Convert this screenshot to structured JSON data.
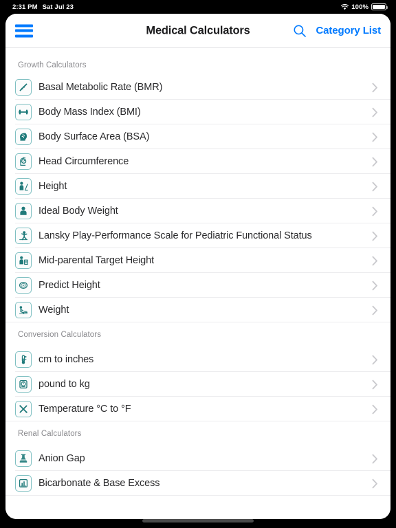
{
  "status_bar": {
    "time": "2:31 PM",
    "date": "Sat Jul 23",
    "battery_percent": "100%",
    "wifi_icon": "wifi-icon",
    "battery_icon": "battery-icon"
  },
  "nav": {
    "menu_icon": "hamburger-menu-icon",
    "title": "Medical Calculators",
    "search_icon": "search-icon",
    "category_list_label": "Category List"
  },
  "colors": {
    "accent_blue": "#007aff",
    "icon_teal": "#1f7a7a",
    "icon_border": "#7fc0c2",
    "section_header_text": "#8a8a8e",
    "row_text": "#2a2a2c",
    "separator": "#ececee"
  },
  "sections": [
    {
      "title": "Growth Calculators",
      "rows": [
        {
          "label": "Basal Metabolic Rate (BMR)",
          "icon": "ruler-icon"
        },
        {
          "label": "Body Mass Index (BMI)",
          "icon": "dumbbell-icon"
        },
        {
          "label": "Body Surface Area (BSA)",
          "icon": "head-brain-icon"
        },
        {
          "label": "Head Circumference",
          "icon": "head-measure-icon"
        },
        {
          "label": "Height",
          "icon": "person-height-icon"
        },
        {
          "label": "Ideal Body Weight",
          "icon": "person-icon"
        },
        {
          "label": "Lansky Play-Performance Scale for Pediatric Functional Status",
          "icon": "child-play-icon"
        },
        {
          "label": "Mid-parental Target Height",
          "icon": "person-chart-icon"
        },
        {
          "label": "Predict Height",
          "icon": "footprint-icon"
        },
        {
          "label": "Weight",
          "icon": "child-weight-icon"
        }
      ]
    },
    {
      "title": "Conversion Calculators",
      "rows": [
        {
          "label": "cm to inches",
          "icon": "measure-convert-icon"
        },
        {
          "label": "pound to kg",
          "icon": "scale-icon"
        },
        {
          "label": "Temperature °C to °F",
          "icon": "thermometer-cross-icon"
        }
      ]
    },
    {
      "title": "Renal Calculators",
      "rows": [
        {
          "label": "Anion Gap",
          "icon": "flask-icon"
        },
        {
          "label": "Bicarbonate & Base Excess",
          "icon": "lab-beaker-icon"
        }
      ]
    }
  ]
}
